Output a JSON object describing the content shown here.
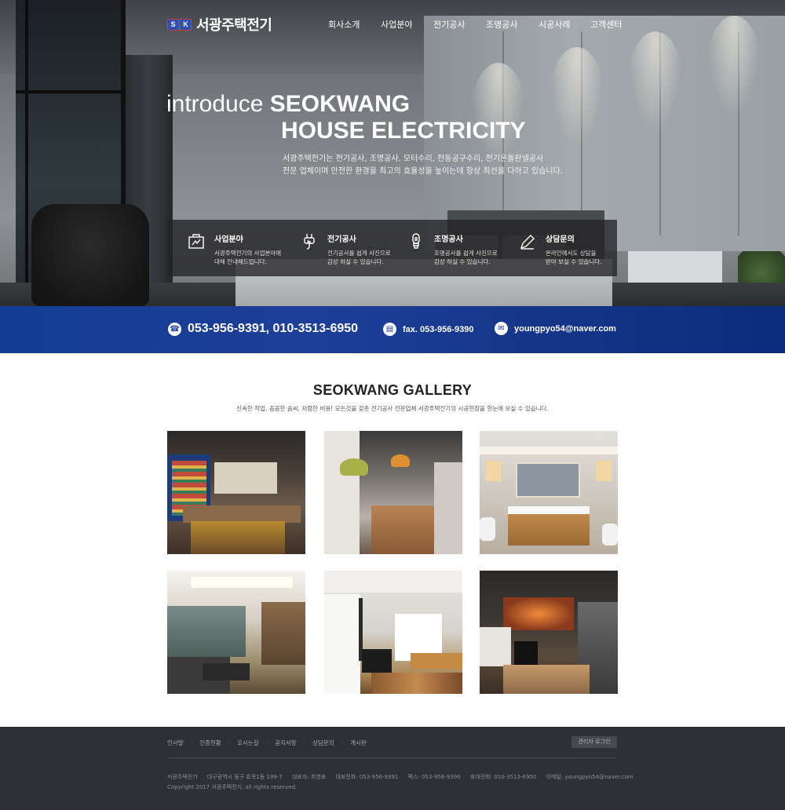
{
  "header": {
    "logo_mark": [
      "S",
      "K"
    ],
    "logo_text": "서광주택전기",
    "nav": [
      "회사소개",
      "사업분야",
      "전기공사",
      "조명공사",
      "시공사례",
      "고객센터"
    ]
  },
  "hero": {
    "intro_light": "introduce",
    "intro_bold_1": "SEOKWANG",
    "intro_bold_2": "HOUSE ELECTRICITY",
    "desc_1": "서광주택전기는 전기공사, 조명공사, 모터수리, 전동공구수리, 전기온돌판넬공사",
    "desc_2": "전문 업체이며 안전한 환경을 최고의 효율성을 높이는데 항상 최선을 다하고 있습니다."
  },
  "features": [
    {
      "icon": "business-icon",
      "title": "사업분야",
      "desc_1": "서광주택전기의 사업분야에",
      "desc_2": "대해 안내해드립니다."
    },
    {
      "icon": "plug-icon",
      "title": "전기공사",
      "desc_1": "전기공사를 쉽게 사진으로",
      "desc_2": "감상 하실 수 있습니다."
    },
    {
      "icon": "bulb-icon",
      "title": "조명공사",
      "desc_1": "조명공사를 쉽게 사진으로",
      "desc_2": "감상 하실 수 있습니다."
    },
    {
      "icon": "pencil-icon",
      "title": "상담문의",
      "desc_1": "온라인에서도 상담을",
      "desc_2": "받아 보실 수 있습니다."
    }
  ],
  "contact": {
    "phone": "053-956-9391, 010-3513-6950",
    "fax": "fax. 053-956-9390",
    "email": "youngpyo54@naver.com"
  },
  "gallery": {
    "title": "SEOKWANG GALLERY",
    "subtitle": "신속한 작업, 꼼꼼한 솜씨, 저렴한 비용! 모든것을 갖춘 전기공사 전문업체 서광주택전기의 시공현장을 한눈에 보실 수 있습니다."
  },
  "footer": {
    "links": [
      "인사말",
      "인증현황",
      "오시는길",
      "공지사항",
      "상담문의",
      "게시판"
    ],
    "admin_login": "관리자 로그인",
    "info": [
      "서광주택전기",
      "대구광역시 동구 효목1동 199-7",
      "대표자: 최영표",
      "대표전화: 053-956-9391",
      "팩스: 053-956-9390",
      "휴대전화: 010-3513-6950",
      "이메일: youngpyo54@naver.com"
    ],
    "copyright": "Copyright 2017 서광주택전기. all rights reserved."
  }
}
